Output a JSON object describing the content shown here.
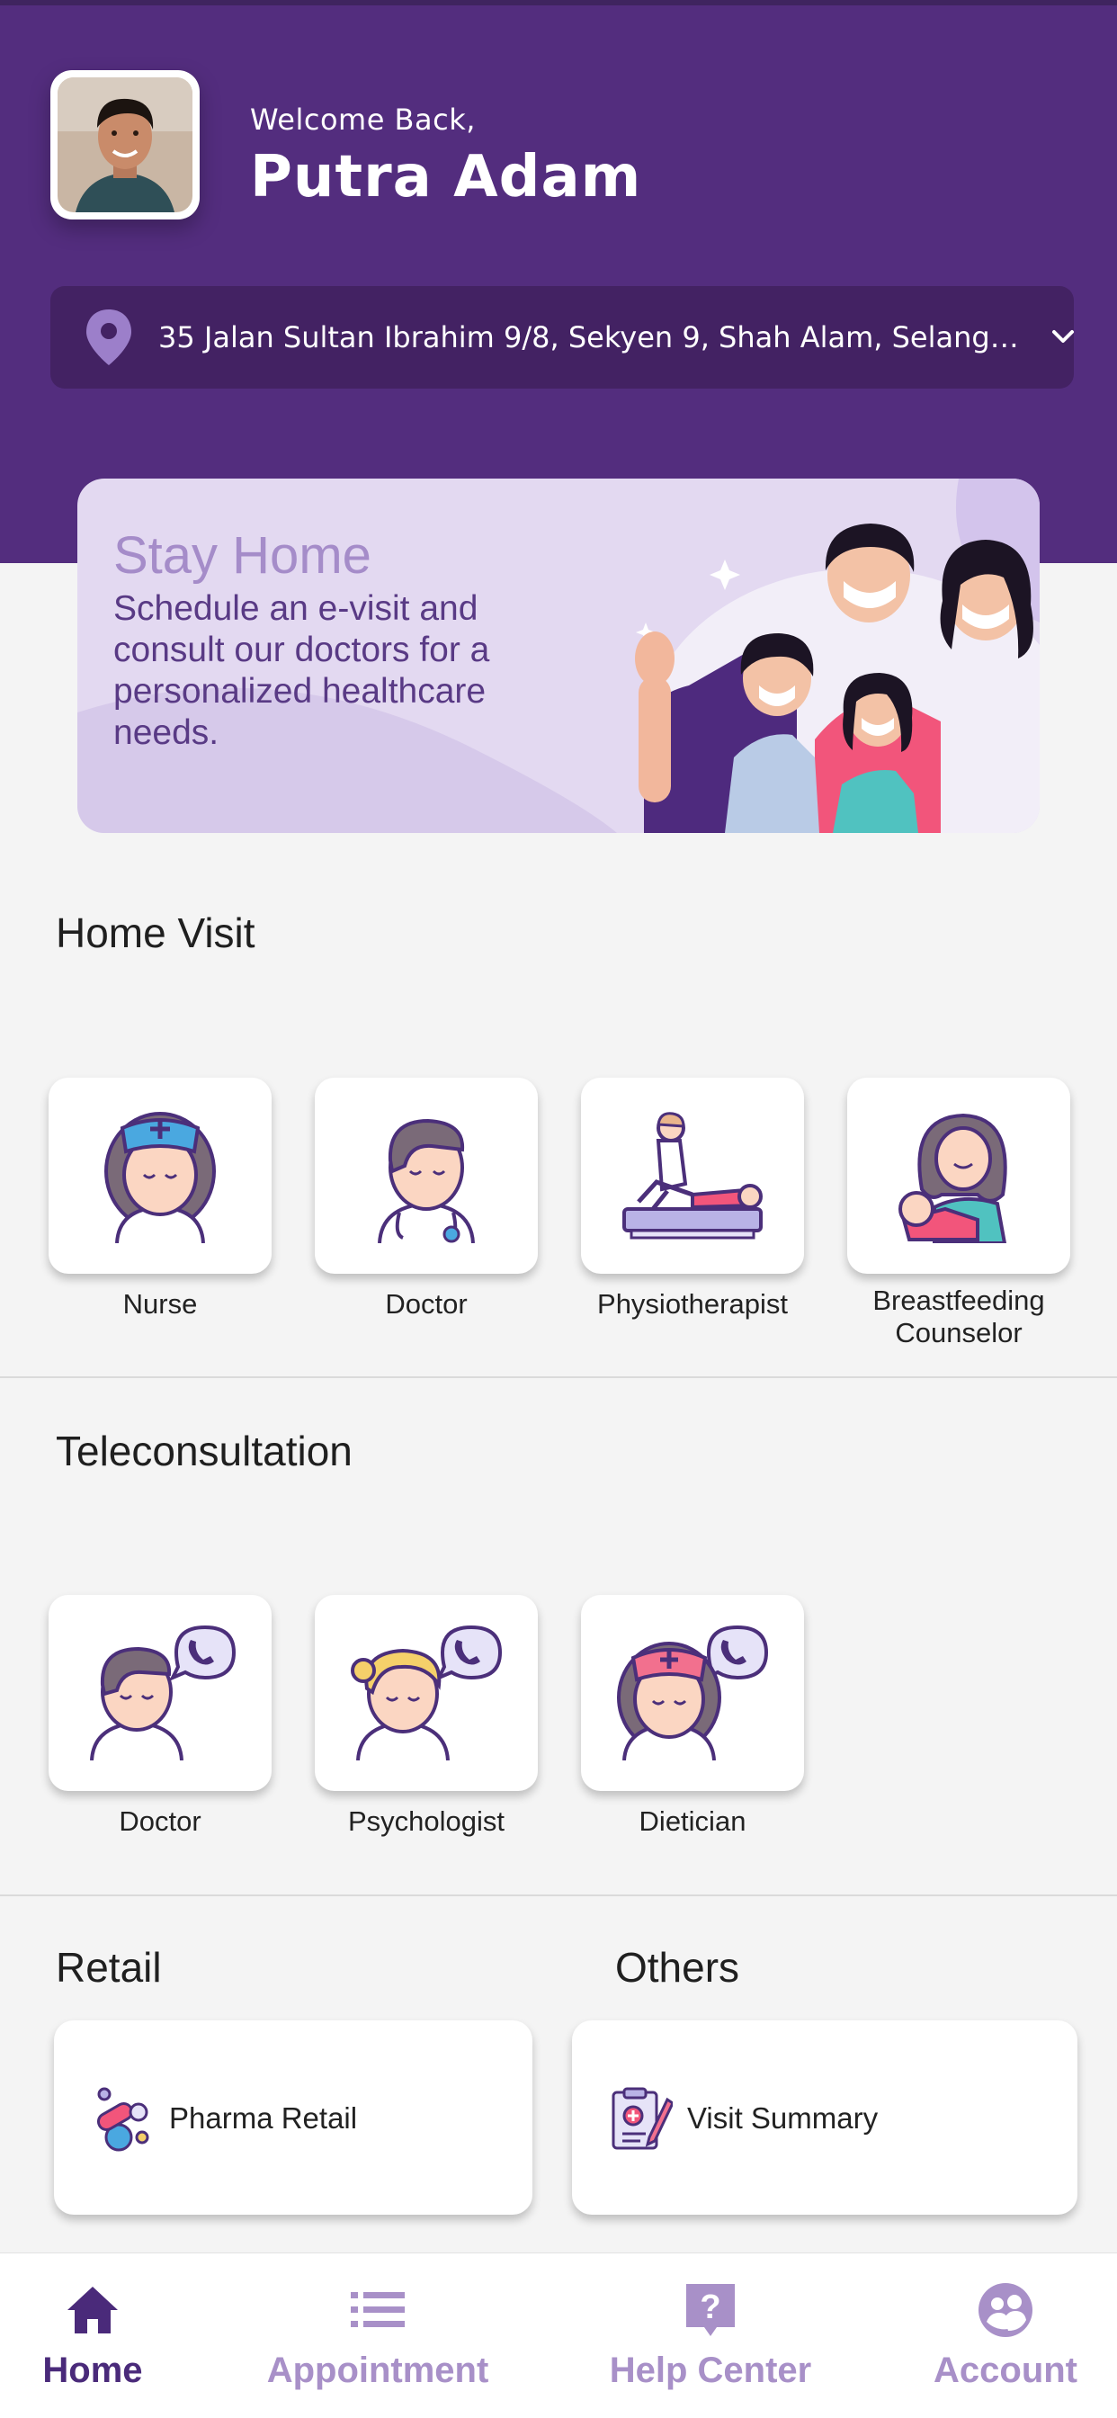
{
  "header": {
    "welcome": "Welcome Back,",
    "user_name": "Putra Adam",
    "address": "35 Jalan Sultan Ibrahim 9/8, Sekyen 9, Shah Alam, Selangor..."
  },
  "banner": {
    "title": "Stay Home",
    "text": "Schedule an e-visit and consult our doctors for a personalized healthcare needs."
  },
  "home_visit": {
    "title": "Home Visit",
    "items": [
      {
        "label": "Nurse",
        "icon": "nurse-icon"
      },
      {
        "label": "Doctor",
        "icon": "doctor-icon"
      },
      {
        "label": "Physiotherapist",
        "icon": "physiotherapist-icon"
      },
      {
        "label": "Breastfeeding Counselor",
        "icon": "breastfeeding-icon"
      }
    ]
  },
  "teleconsultation": {
    "title": "Teleconsultation",
    "items": [
      {
        "label": "Doctor",
        "icon": "doctor-call-icon"
      },
      {
        "label": "Psychologist",
        "icon": "psychologist-call-icon"
      },
      {
        "label": "Dietician",
        "icon": "dietician-call-icon"
      }
    ]
  },
  "retail": {
    "title": "Retail",
    "item": {
      "label": "Pharma Retail",
      "icon": "pills-icon"
    }
  },
  "others": {
    "title": "Others",
    "item": {
      "label": "Visit Summary",
      "icon": "clipboard-icon"
    }
  },
  "nav": {
    "items": [
      {
        "label": "Home",
        "icon": "home-icon",
        "active": true
      },
      {
        "label": "Appointment",
        "icon": "list-icon"
      },
      {
        "label": "Help Center",
        "icon": "help-icon"
      },
      {
        "label": "Account",
        "icon": "account-icon"
      }
    ]
  },
  "colors": {
    "header": "#532d7e",
    "address_bar": "#432263",
    "accent": "#4a2a7a",
    "nav_inactive": "#a890c8",
    "background": "#f4f4f4"
  }
}
